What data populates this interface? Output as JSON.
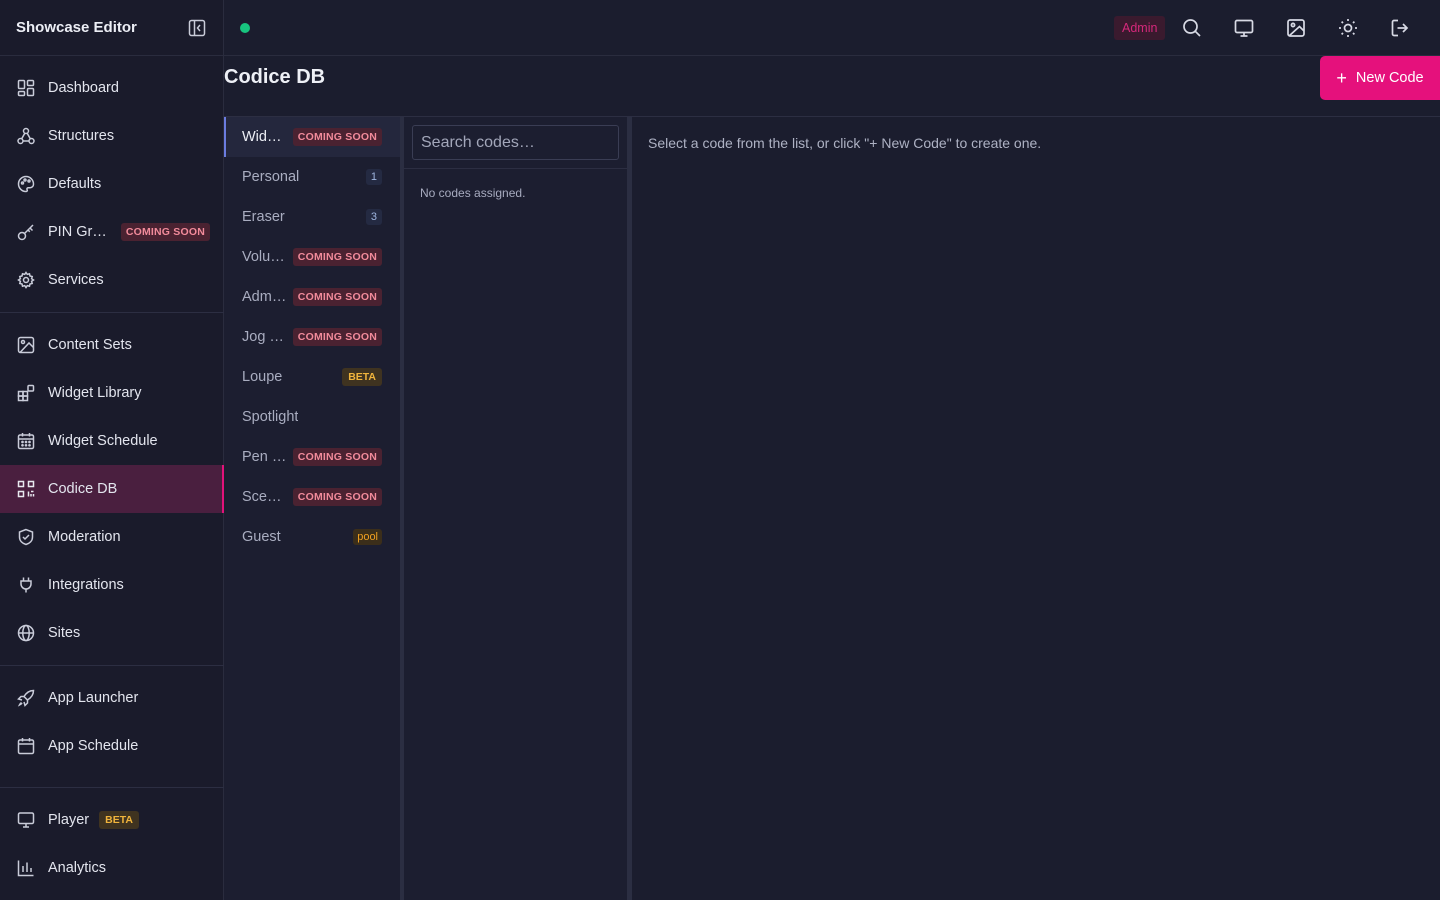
{
  "app": {
    "title": "Showcase Editor"
  },
  "sidebar": {
    "items": [
      {
        "label": "Dashboard",
        "icon": "dashboard-icon"
      },
      {
        "label": "Structures",
        "icon": "structures-icon"
      },
      {
        "label": "Defaults",
        "icon": "palette-icon"
      },
      {
        "label": "PIN Gr…",
        "icon": "key-icon",
        "badge": "COMING SOON"
      },
      {
        "label": "Services",
        "icon": "gear-icon"
      },
      {
        "label": "Content Sets",
        "icon": "image-icon"
      },
      {
        "label": "Widget Library",
        "icon": "widgets-icon"
      },
      {
        "label": "Widget Schedule",
        "icon": "calendar-grid-icon"
      },
      {
        "label": "Codice DB",
        "icon": "qr-icon",
        "active": true
      },
      {
        "label": "Moderation",
        "icon": "shield-icon"
      },
      {
        "label": "Integrations",
        "icon": "plug-icon"
      },
      {
        "label": "Sites",
        "icon": "globe-icon"
      },
      {
        "label": "App Launcher",
        "icon": "rocket-icon"
      },
      {
        "label": "App Schedule",
        "icon": "calendar-icon"
      },
      {
        "label": "Player",
        "icon": "monitor-icon",
        "badge": "BETA"
      },
      {
        "label": "Analytics",
        "icon": "chart-icon"
      }
    ]
  },
  "topbar": {
    "role_badge": "Admin",
    "status_color": "#18c47f",
    "icons": [
      "search-icon",
      "monitor-icon",
      "image-icon",
      "sun-icon",
      "logout-icon"
    ]
  },
  "page": {
    "title": "Codice DB",
    "new_button_label": "New Code",
    "new_button_plus": "+"
  },
  "categories": [
    {
      "label": "Wid…",
      "badge": "COMING SOON",
      "badge_type": "cs",
      "active": true
    },
    {
      "label": "Personal",
      "badge": "1",
      "badge_type": "count"
    },
    {
      "label": "Eraser",
      "badge": "3",
      "badge_type": "count"
    },
    {
      "label": "Volu…",
      "badge": "COMING SOON",
      "badge_type": "cs"
    },
    {
      "label": "Adm…",
      "badge": "COMING SOON",
      "badge_type": "cs"
    },
    {
      "label": "Jog …",
      "badge": "COMING SOON",
      "badge_type": "cs"
    },
    {
      "label": "Loupe",
      "badge": "BETA",
      "badge_type": "beta"
    },
    {
      "label": "Spotlight",
      "badge": "",
      "badge_type": ""
    },
    {
      "label": "Pen …",
      "badge": "COMING SOON",
      "badge_type": "cs"
    },
    {
      "label": "Sce…",
      "badge": "COMING SOON",
      "badge_type": "cs"
    },
    {
      "label": "Guest",
      "badge": "pool",
      "badge_type": "pool"
    }
  ],
  "code_list": {
    "search_placeholder": "Search codes…",
    "empty_message": "No codes assigned."
  },
  "detail": {
    "message": "Select a code from the list, or click \"+ New Code\" to create one."
  },
  "colors": {
    "accent": "#e5117c",
    "active_sidebar_bg": "#4a1f3f",
    "background": "#1b1d2e"
  }
}
